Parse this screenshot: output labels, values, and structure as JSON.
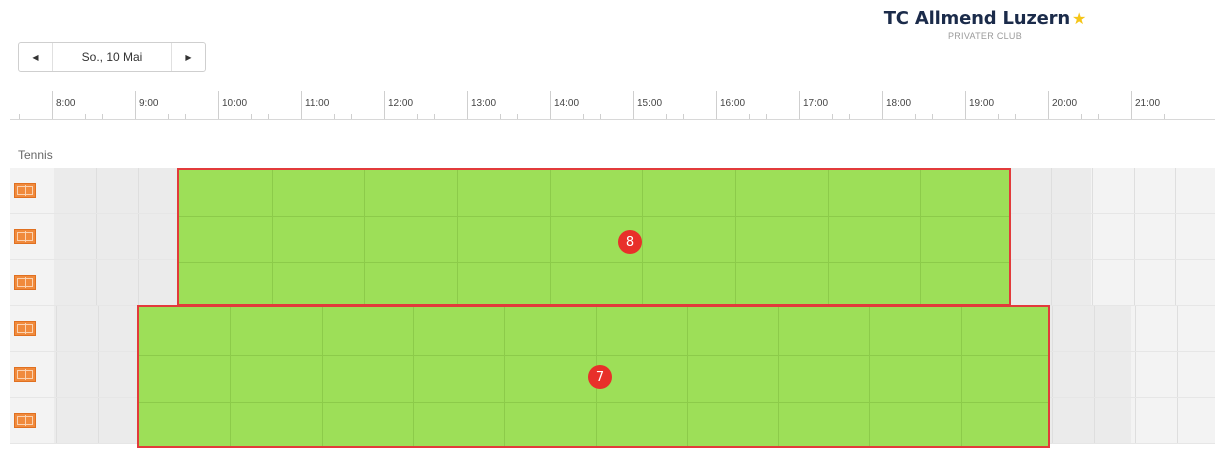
{
  "club": {
    "name": "TC Allmend Luzern",
    "subtitle": "PRIVATER CLUB",
    "star_icon": "star-icon",
    "star_color": "#f5c518"
  },
  "date_nav": {
    "prev_icon": "caret-left-icon",
    "next_icon": "caret-right-icon",
    "date": "So., 10 Mai"
  },
  "timeline": {
    "hours": [
      "8:00",
      "9:00",
      "10:00",
      "11:00",
      "12:00",
      "13:00",
      "14:00",
      "15:00",
      "16:00",
      "17:00",
      "18:00",
      "19:00",
      "20:00",
      "21:00"
    ]
  },
  "section": {
    "label": "Tennis"
  },
  "courts": [
    {
      "icon": "tennis-court-icon"
    },
    {
      "icon": "tennis-court-icon"
    },
    {
      "icon": "tennis-court-icon"
    },
    {
      "icon": "tennis-court-icon"
    },
    {
      "icon": "tennis-court-icon"
    },
    {
      "icon": "tennis-court-icon"
    }
  ],
  "bookings": [
    {
      "badge": "8",
      "color": "#9ddf58",
      "outline": "#e23b3b"
    },
    {
      "badge": "7",
      "color": "#9ddf58",
      "outline": "#e23b3b"
    }
  ]
}
